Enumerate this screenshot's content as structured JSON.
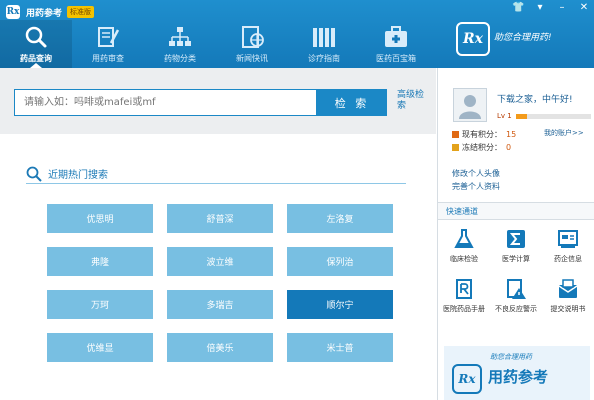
{
  "app": {
    "logo_text": "Rx",
    "title": "用药参考",
    "edition": "标准版"
  },
  "window_controls": {
    "skin": "👕",
    "menu": "▾",
    "minimize": "–",
    "close": "✕"
  },
  "nav": {
    "items": [
      {
        "label": "药品查询",
        "icon": "magnifier-icon"
      },
      {
        "label": "用药审查",
        "icon": "review-icon"
      },
      {
        "label": "药物分类",
        "icon": "hierarchy-icon"
      },
      {
        "label": "新闻快讯",
        "icon": "news-icon"
      },
      {
        "label": "诊疗指南",
        "icon": "books-icon"
      },
      {
        "label": "医药百宝箱",
        "icon": "medkit-icon"
      }
    ],
    "active_index": 0
  },
  "header": {
    "brand_logo": "Rx",
    "slogan": "助您合理用药!"
  },
  "search": {
    "placeholder": "请输入如：吗啡或mafei或mf",
    "button_label": "检 索",
    "advanced_label": "高级检索"
  },
  "hot": {
    "title": "近期热门搜索",
    "items": [
      "优思明",
      "舒普深",
      "左洛复",
      "弗隆",
      "波立维",
      "保列治",
      "万珂",
      "多瑞吉",
      "顺尔宁",
      "优维显",
      "倍美乐",
      "米士普"
    ],
    "selected_index": 8
  },
  "user": {
    "greeting": "下载之家，中午好!",
    "level_label": "Lv 1",
    "level_progress": 0.15,
    "points_label": "现有积分：",
    "points_value": "15",
    "frozen_label": "冻结积分：",
    "frozen_value": "0",
    "my_account": "我的账户>>",
    "links": [
      "修改个人头像",
      "完善个人资料"
    ]
  },
  "quick": {
    "title": "快速通道",
    "items": [
      {
        "label": "临床检验",
        "icon": "flask-icon"
      },
      {
        "label": "医学计算",
        "icon": "sigma-icon"
      },
      {
        "label": "药企信息",
        "icon": "company-icon"
      },
      {
        "label": "医院药品手册",
        "icon": "manual-icon"
      },
      {
        "label": "不良反应警示",
        "icon": "warning-icon"
      },
      {
        "label": "提交说明书",
        "icon": "submit-icon"
      }
    ]
  },
  "banner": {
    "logo": "Rx",
    "slogan": "助您合理用药",
    "title": "用药参考"
  },
  "colors": {
    "primary": "#1479b9",
    "tile": "#78bfe2",
    "tile_selected": "#1479b9",
    "accent": "#f39b1b"
  }
}
